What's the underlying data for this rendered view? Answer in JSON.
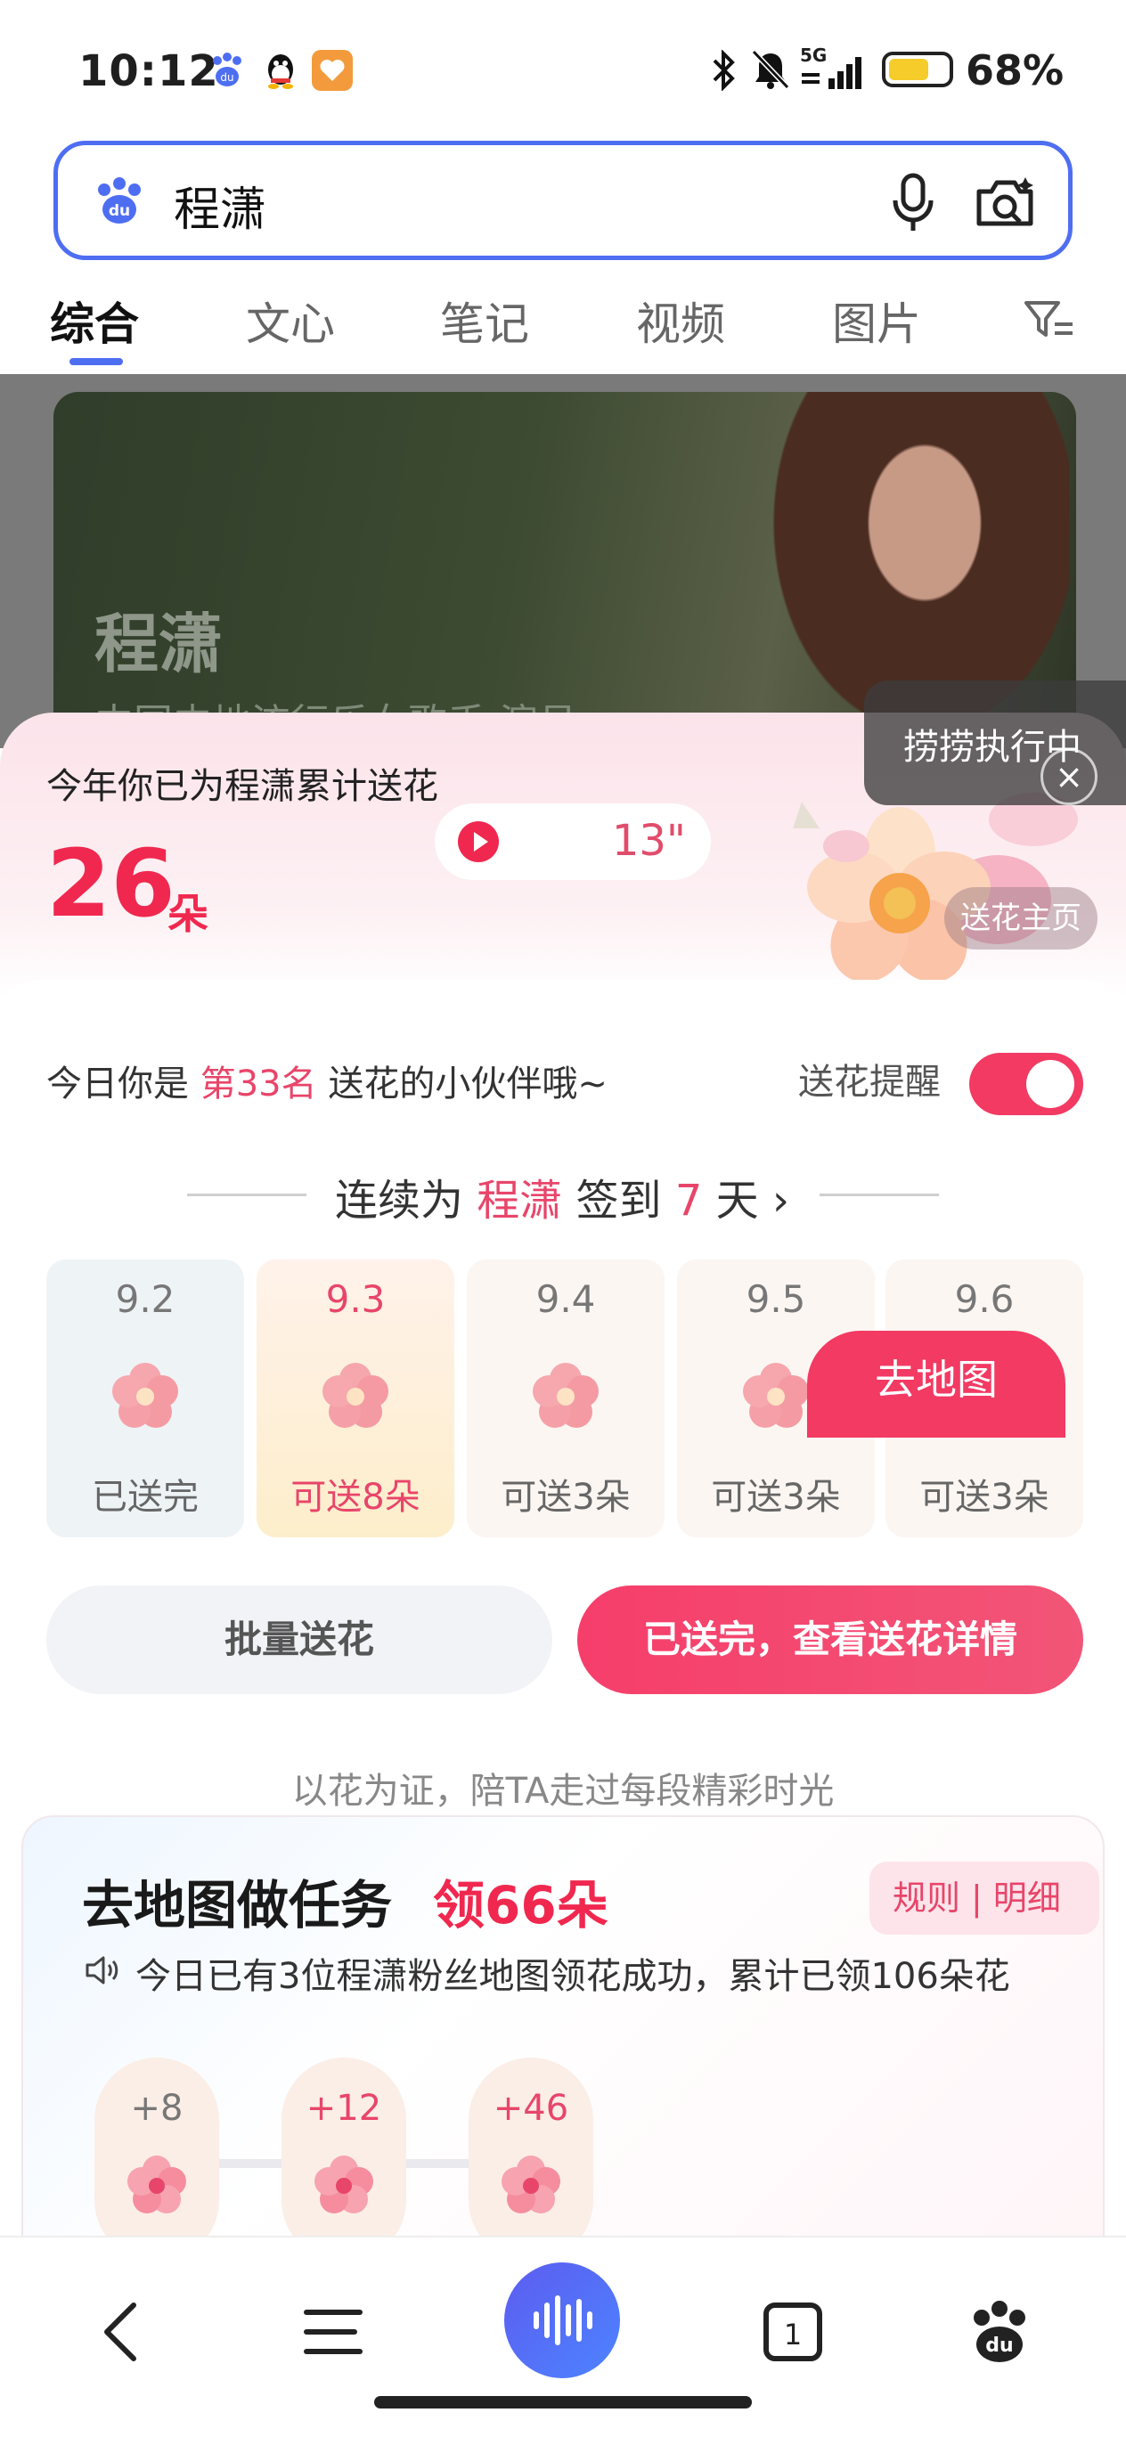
{
  "status_bar": {
    "time": "10:12",
    "network": "5G",
    "battery": "68%"
  },
  "search": {
    "query": "程潇"
  },
  "tabs": [
    {
      "label": "综合",
      "active": true
    },
    {
      "label": "文心"
    },
    {
      "label": "笔记"
    },
    {
      "label": "视频"
    },
    {
      "label": "图片"
    }
  ],
  "hero": {
    "name": "程潇",
    "subtitle": "中国内地流行乐女歌手 演员"
  },
  "task_chip": {
    "label": "捞捞执行中",
    "close": "×"
  },
  "flower_summary": {
    "label": "今年你已为程潇累计送花",
    "count": "26",
    "unit": "朵",
    "audio_duration": "13\"",
    "home_label": "送花主页"
  },
  "rank": {
    "prefix": "今日你是 ",
    "rank": "第33名",
    "suffix": " 送花的小伙伴哦~"
  },
  "reminder": {
    "label": "送花提醒",
    "on": true
  },
  "streak": {
    "prefix": "连续为 ",
    "name": "程潇",
    "middle": " 签到 ",
    "days": "7",
    "suffix": " 天 ›"
  },
  "days": [
    {
      "date": "9.2",
      "status": "已送完"
    },
    {
      "date": "9.3",
      "status": "可送8朵"
    },
    {
      "date": "9.4",
      "status": "可送3朵"
    },
    {
      "date": "9.5",
      "status": "可送3朵"
    },
    {
      "date": "9.6",
      "status": "可送3朵"
    }
  ],
  "buttons": {
    "batch": "批量送花",
    "details": "已送完，查看送花详情"
  },
  "tagline": "以花为证，陪TA走过每段精彩时光",
  "map_task": {
    "title": "去地图做任务",
    "reward": "领66朵",
    "rules": "规则",
    "details": "明细",
    "notice": "今日已有3位程潇粉丝地图领花成功，累计已领106朵花",
    "nodes": [
      "+8",
      "+12",
      "+46"
    ],
    "go_button": "去地图"
  },
  "colors": {
    "accent": "#f23a63",
    "brand": "#4e6ef2"
  },
  "icons": [
    "bluetooth-icon",
    "mute-icon",
    "signal-icon",
    "microphone-icon",
    "camera-search-icon",
    "filter-icon",
    "back-icon",
    "menu-icon",
    "voice-icon",
    "tabs-icon",
    "baidu-icon"
  ]
}
